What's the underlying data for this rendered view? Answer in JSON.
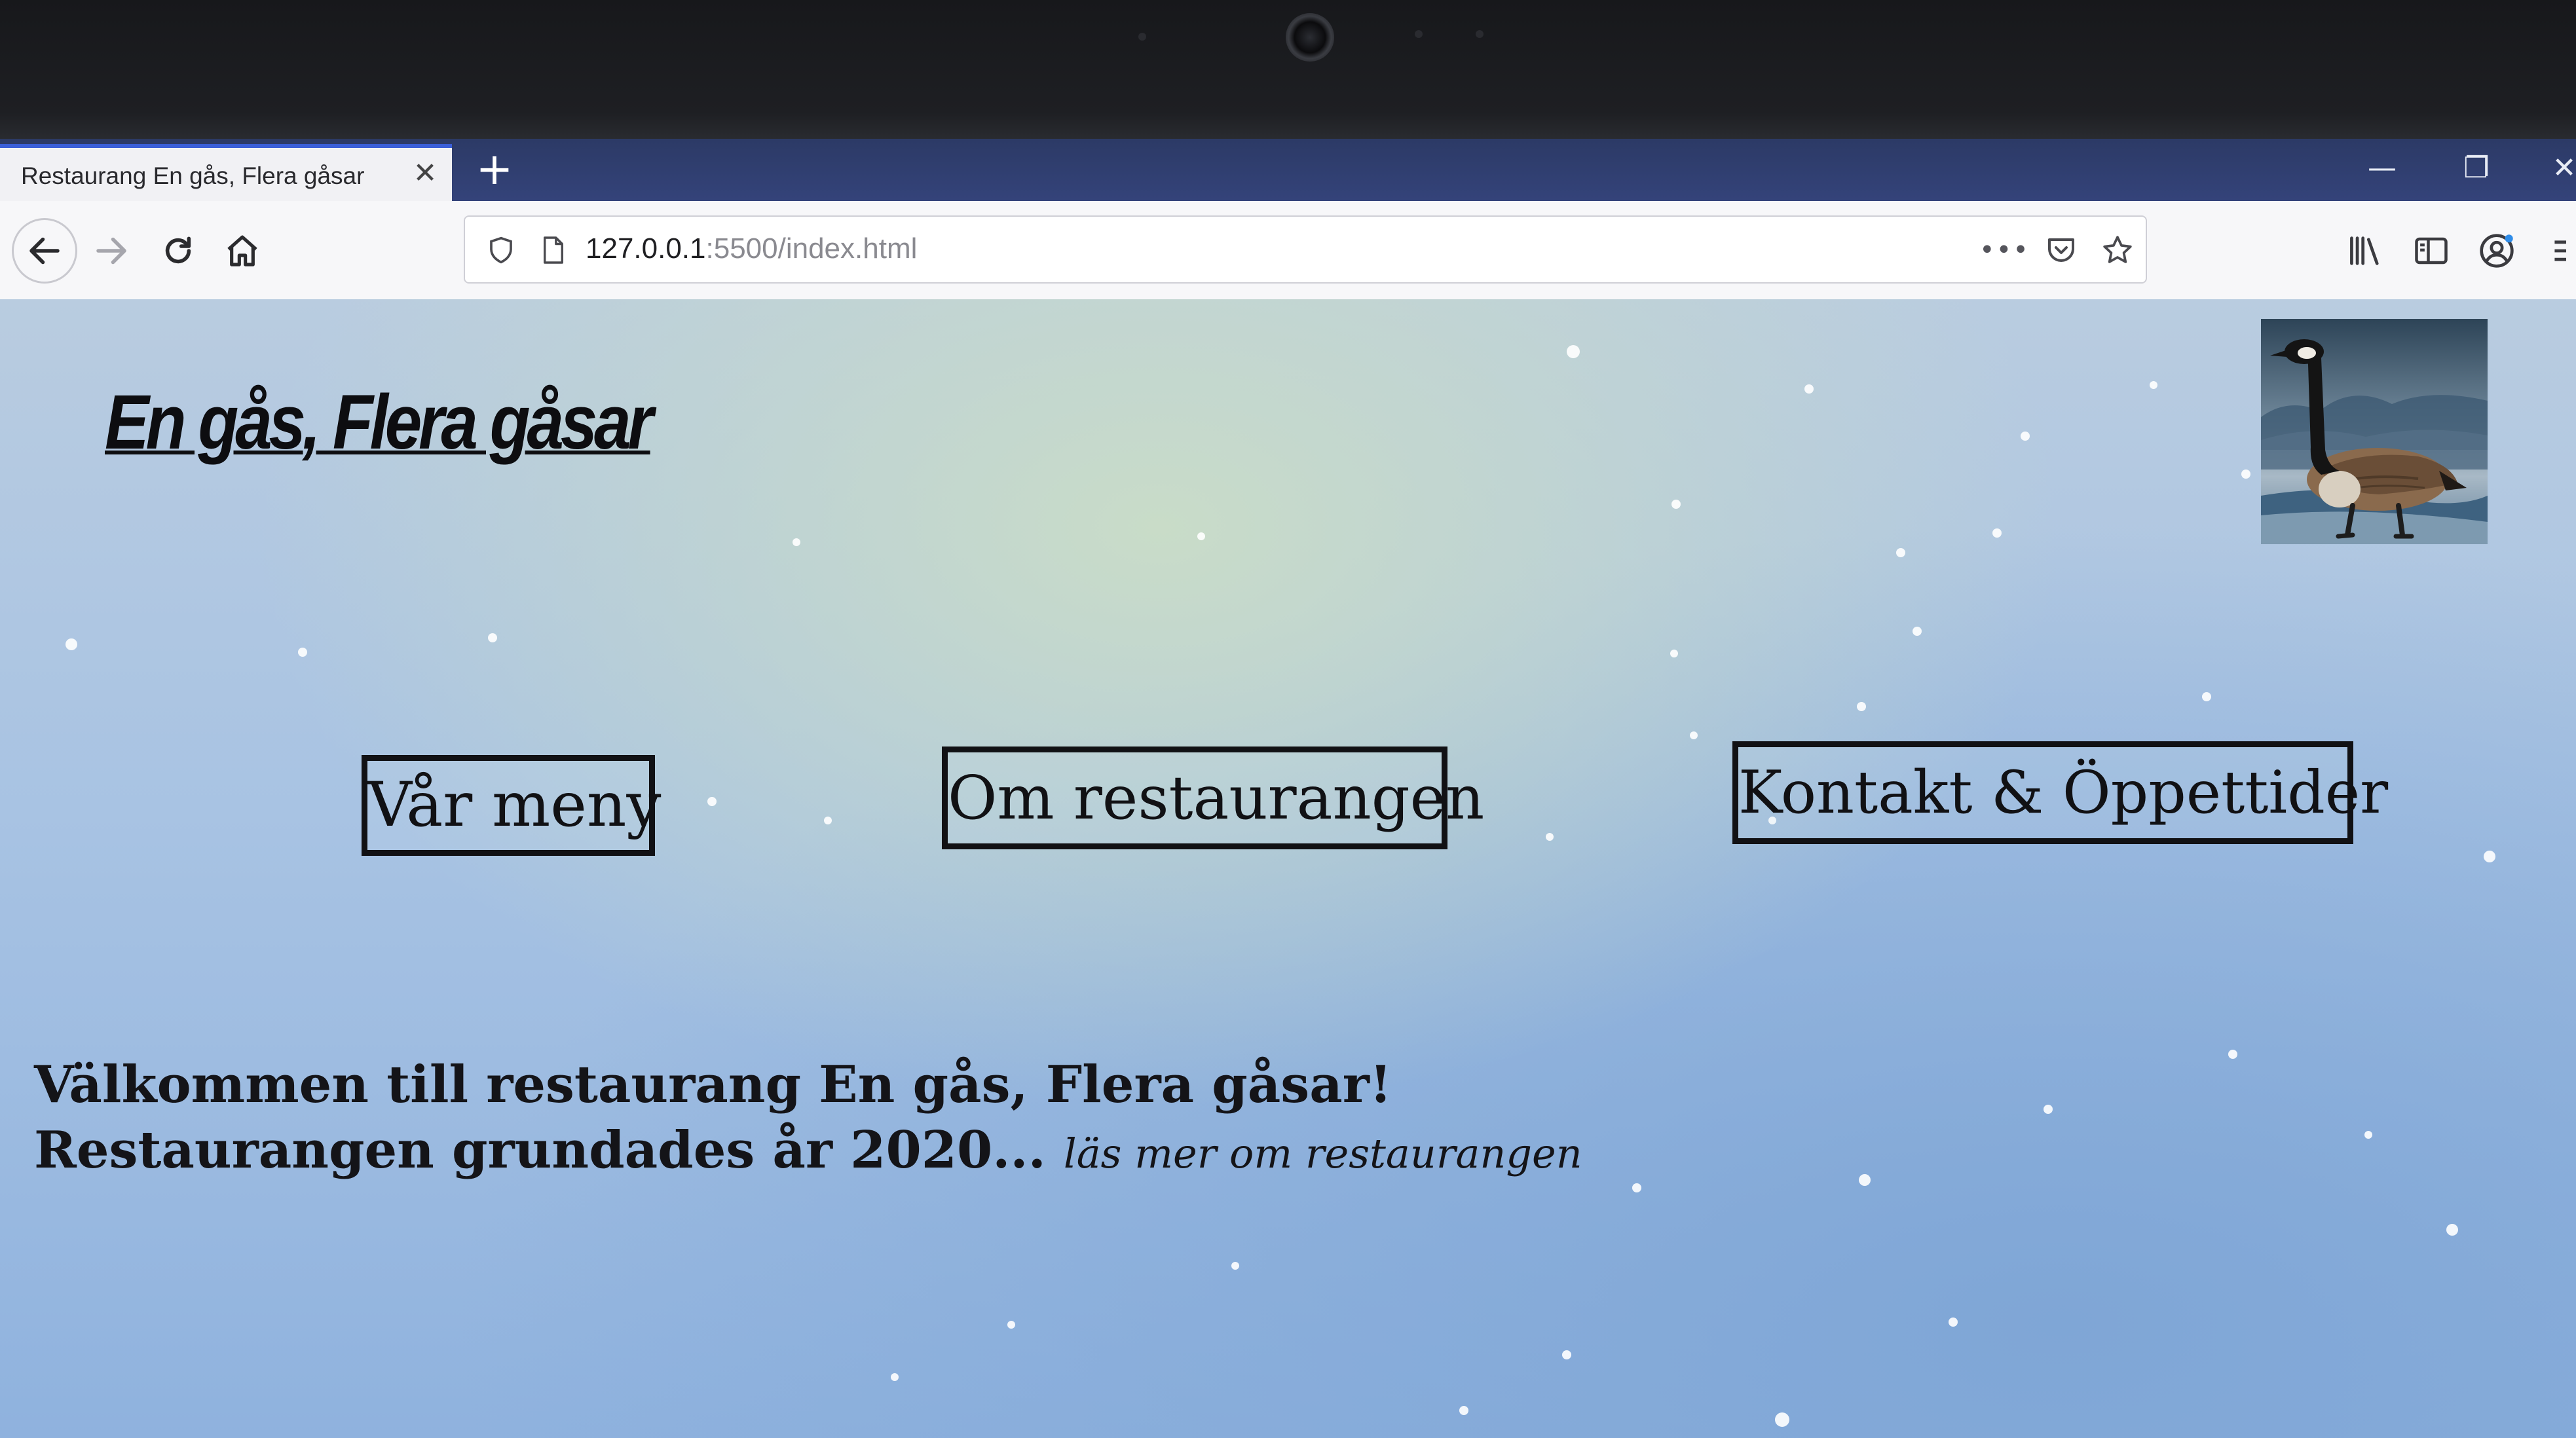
{
  "browser": {
    "tab_title": "Restaurang En gås, Flera gåsar",
    "tab_close": "✕",
    "new_tab": "+",
    "url_host": "127.0.0.1",
    "url_rest": ":5500/index.html",
    "window_controls": {
      "minimize": "—",
      "restore": "❐",
      "close": "✕"
    }
  },
  "site": {
    "title": "En gås, Flera gåsar",
    "logo_icon": "canada-goose-image"
  },
  "nav": [
    {
      "label": "Vår meny"
    },
    {
      "label": "Om restaurangen"
    },
    {
      "label": "Kontakt & Öppettider"
    }
  ],
  "intro": {
    "welcome": "Välkommen till restaurang En gås, Flera gåsar!",
    "founded": "Restaurangen grundades år 2020...",
    "read_more": "läs mer om restaurangen"
  },
  "colors": {
    "tab_accent": "#3b5fd8",
    "tabstrip": "#2c3a66",
    "page_background": "#a8c3e3",
    "text": "#111114"
  }
}
